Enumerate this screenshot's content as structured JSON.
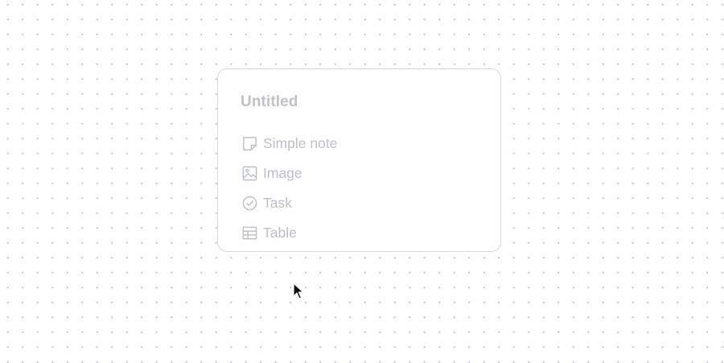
{
  "card": {
    "title": "Untitled",
    "items": [
      {
        "label": "Simple note",
        "icon": "note-icon"
      },
      {
        "label": "Image",
        "icon": "image-icon"
      },
      {
        "label": "Task",
        "icon": "check-circle-icon"
      },
      {
        "label": "Table",
        "icon": "table-icon"
      }
    ]
  },
  "colors": {
    "background": "#ffffff",
    "dot": "#c9cbd1",
    "card_border": "#d7d9de",
    "placeholder_text": "#bcc0c7"
  }
}
